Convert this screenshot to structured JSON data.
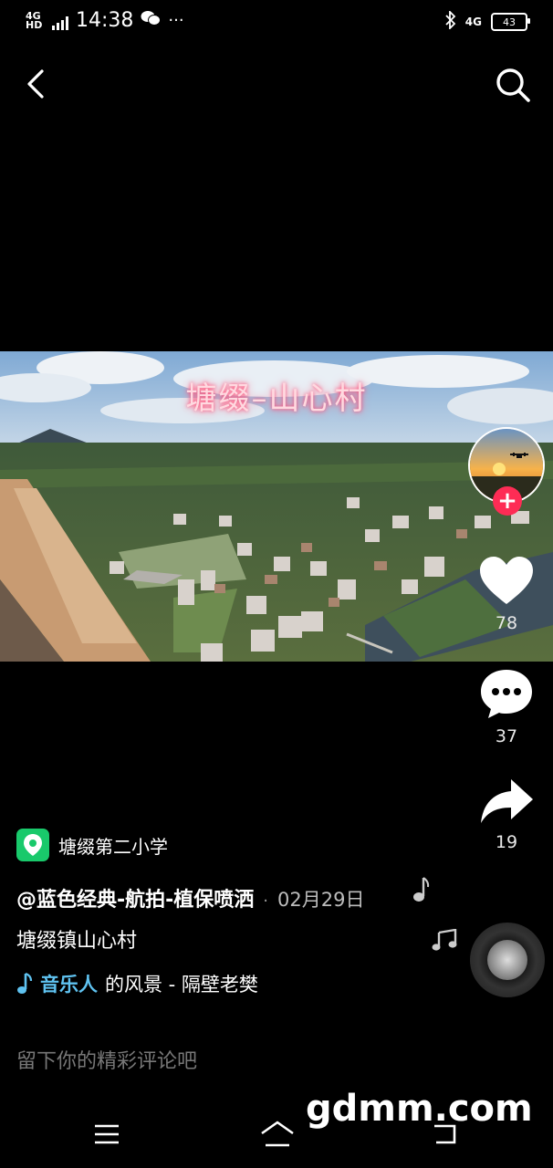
{
  "status_bar": {
    "network": "4G HD",
    "time": "14:38",
    "more": "···",
    "right_network": "4G",
    "battery": "43"
  },
  "video": {
    "overlay_title": "塘缀–山心村"
  },
  "actions": {
    "likes": "78",
    "comments": "37",
    "shares": "19"
  },
  "info": {
    "location": "塘缀第二小学",
    "author": "@蓝色经典-航拍-植保喷洒",
    "separator": "·",
    "date": "02月29日",
    "description": "塘缀镇山心村",
    "music_author": "音乐人",
    "music_title": "的风景 - 隔壁老樊"
  },
  "comment_placeholder": "留下你的精彩评论吧",
  "watermark": "gdmm.com"
}
